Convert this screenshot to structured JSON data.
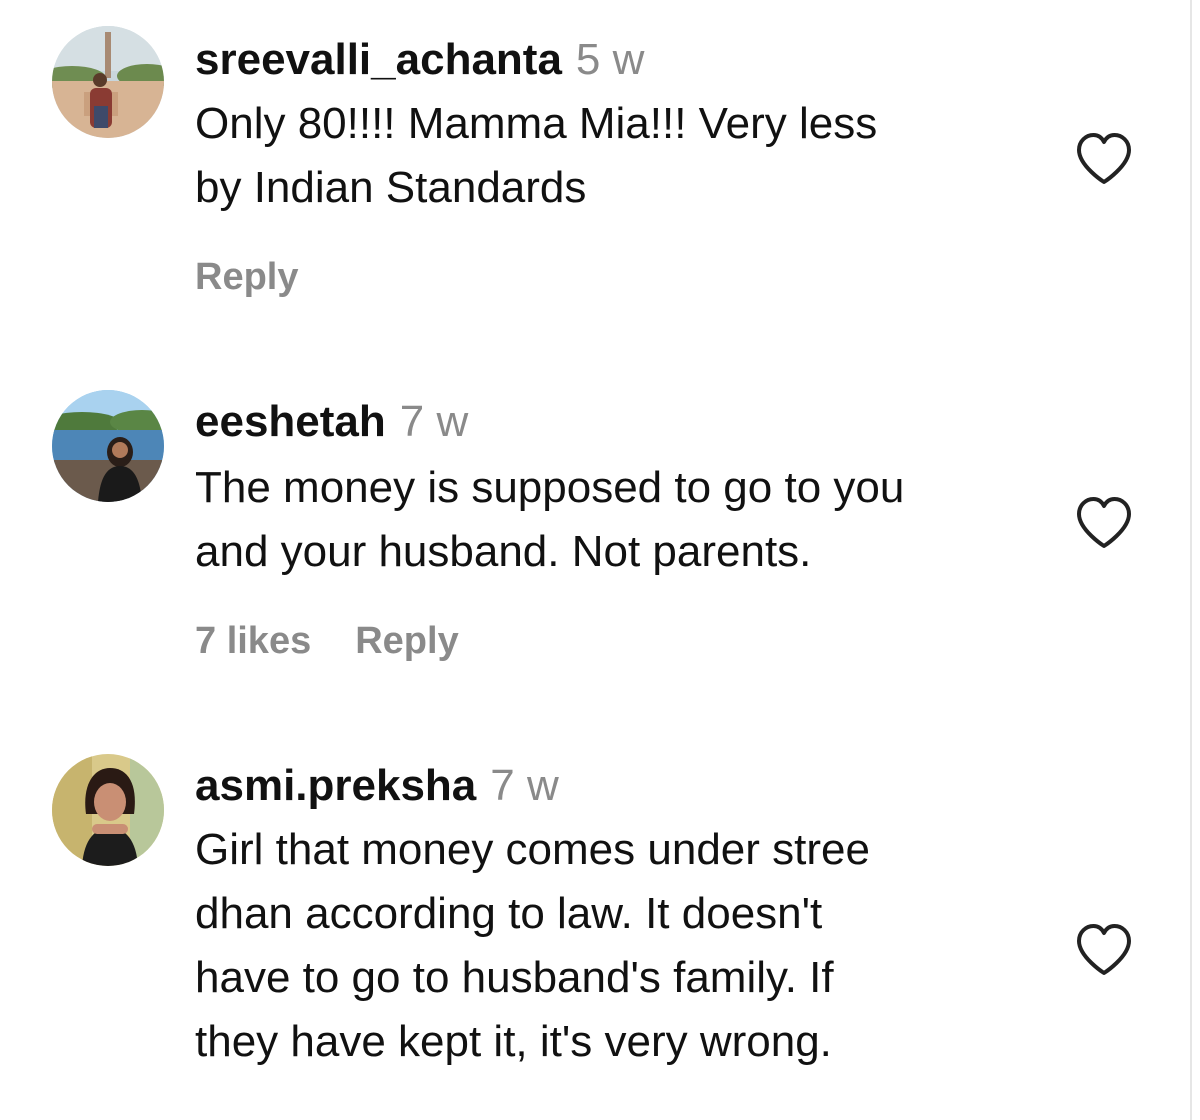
{
  "comments": [
    {
      "username": "sreevalli_achanta",
      "time": "5 w",
      "text_lines": [
        "Only 80!!!! Mamma Mia!!! Very less",
        "by Indian Standards"
      ],
      "likes": "",
      "reply_label": "Reply"
    },
    {
      "username": "eeshetah",
      "time": "7 w",
      "text_lines": [
        "The money is supposed to go to you",
        "and your husband. Not parents."
      ],
      "likes": "7 likes",
      "reply_label": "Reply"
    },
    {
      "username": "asmi.preksha",
      "time": "7 w",
      "text_lines": [
        "Girl that money comes under stree",
        "dhan according to law. It doesn't",
        "have to go to husband's family. If",
        "they have kept it, it's very wrong."
      ],
      "likes": "",
      "reply_label": ""
    }
  ],
  "icons": {
    "like": "heart-outline-icon"
  },
  "colors": {
    "text": "#111111",
    "secondary": "#8a8a8a",
    "icon": "#222222"
  }
}
